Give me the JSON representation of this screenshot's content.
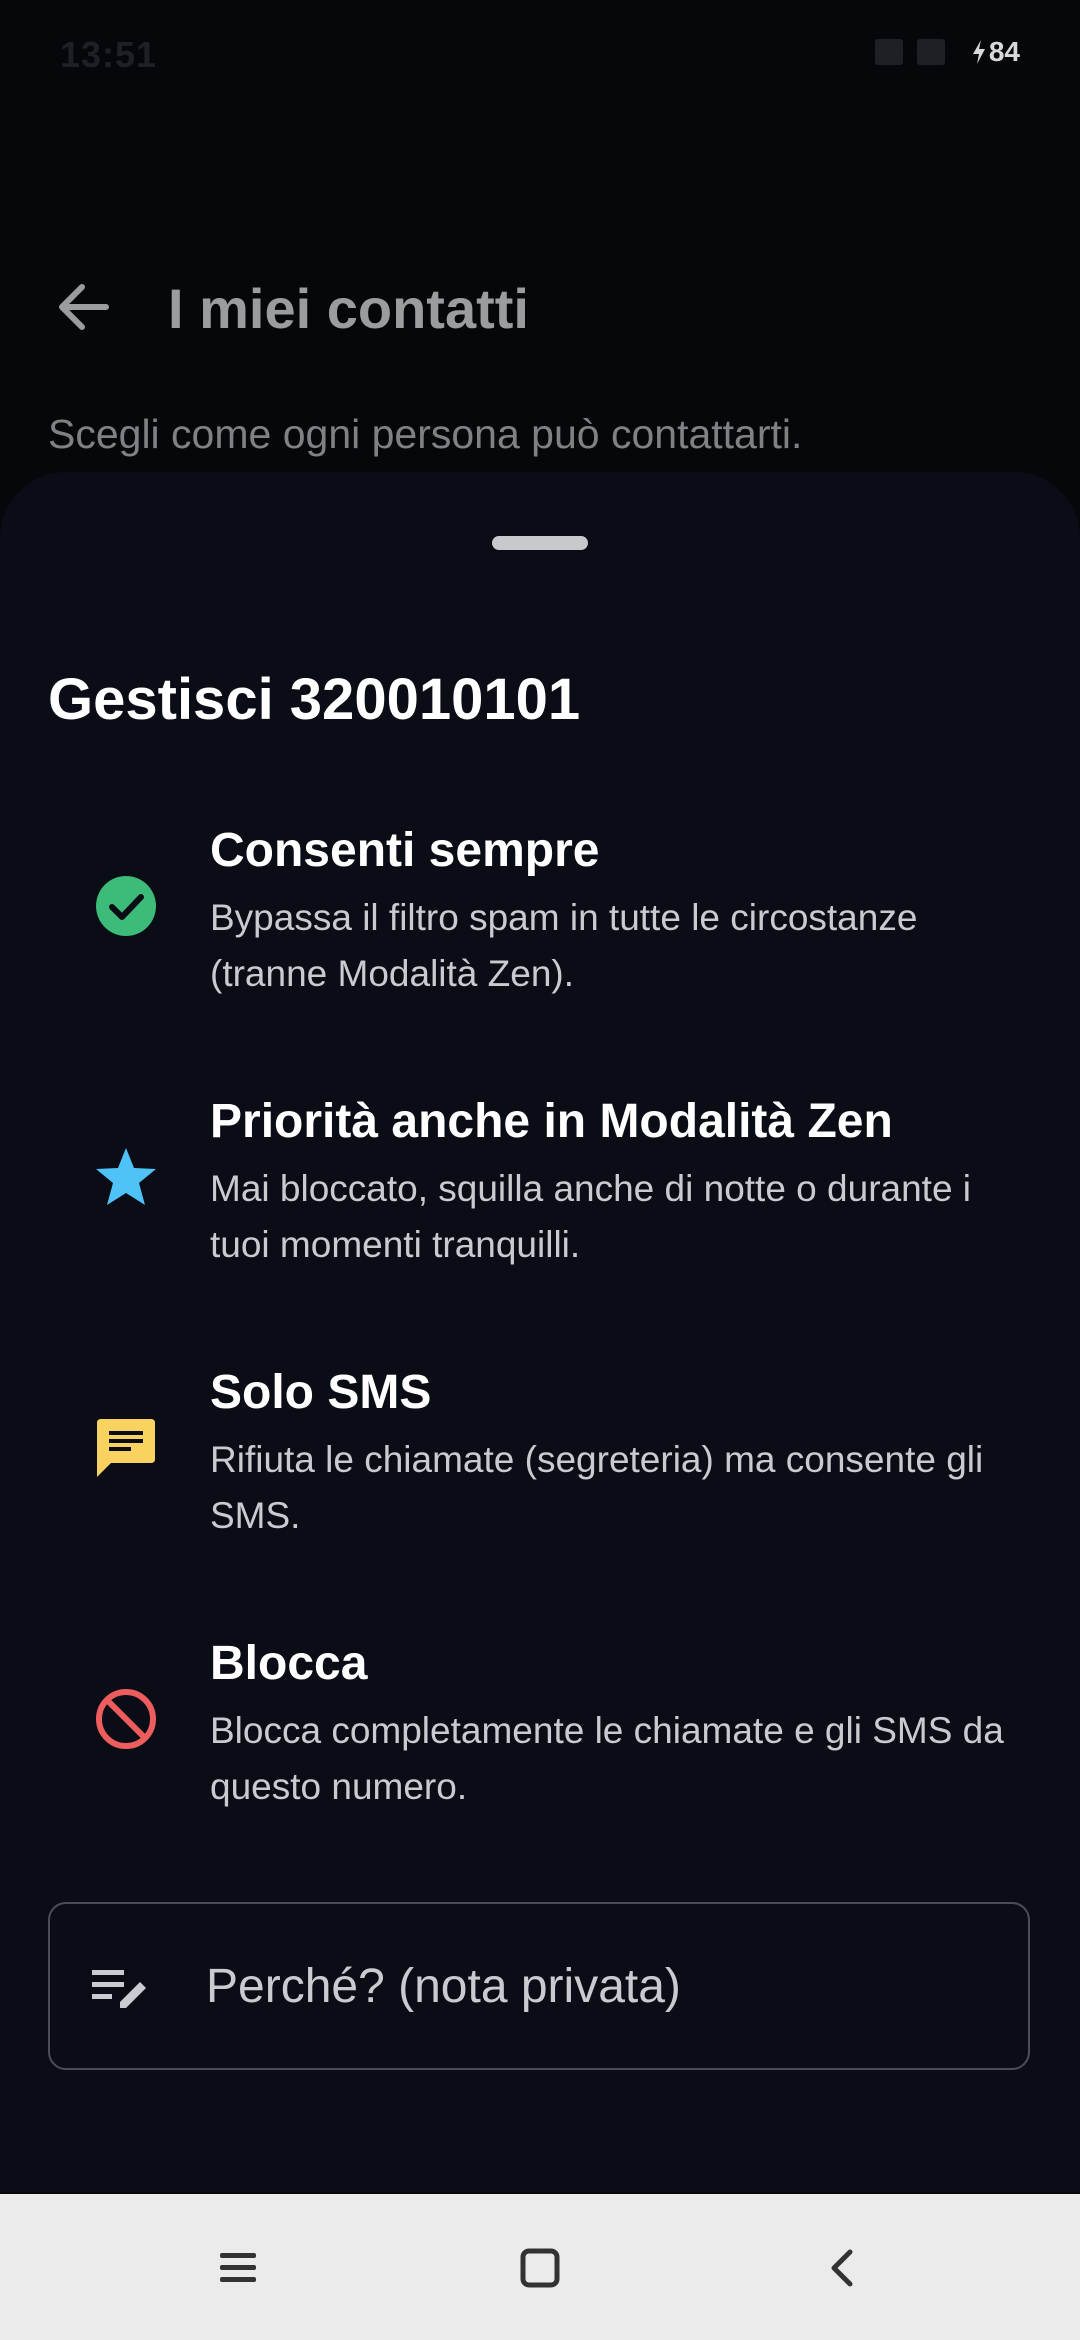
{
  "status_bar": {
    "time": "13:51",
    "battery_level": "84",
    "battery_icon": "charging-bolt-icon"
  },
  "header": {
    "back_icon": "arrow-left-icon",
    "title": "I miei contatti",
    "subtitle": "Scegli come ogni persona può contattarti."
  },
  "sheet": {
    "title": "Gestisci 320010101",
    "options": [
      {
        "icon": "check-circle-icon",
        "icon_color": "#3dbb78",
        "title": "Consenti sempre",
        "description": "Bypassa il filtro spam in tutte le circostanze (tranne Modalità Zen)."
      },
      {
        "icon": "star-icon",
        "icon_color": "#4fc3f7",
        "title": "Priorità anche in Modalità Zen",
        "description": "Mai bloccato, squilla anche di notte o durante i tuoi momenti tranquilli."
      },
      {
        "icon": "message-icon",
        "icon_color": "#f9d25f",
        "title": "Solo SMS",
        "description": "Rifiuta le chiamate (segreteria) ma consente gli SMS."
      },
      {
        "icon": "block-icon",
        "icon_color": "#ee5d5d",
        "title": "Blocca",
        "description": "Blocca completamente le chiamate e gli SMS da questo numero."
      }
    ],
    "note": {
      "icon": "edit-note-icon",
      "placeholder": "Perché? (nota privata)"
    }
  },
  "nav_bar": {
    "menu_icon": "menu-icon",
    "home_icon": "square-home-icon",
    "back_icon": "chevron-left-icon"
  }
}
